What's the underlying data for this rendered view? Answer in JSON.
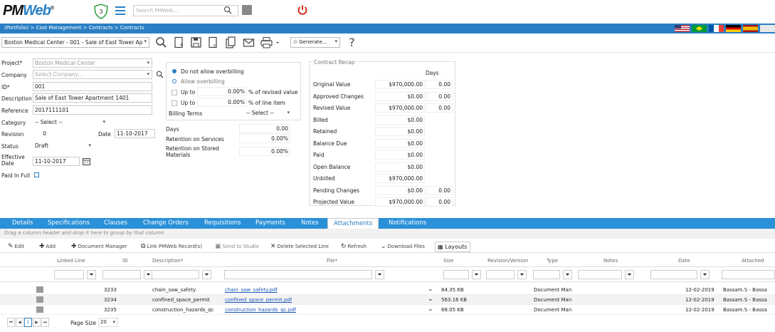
{
  "app": {
    "logo_text_a": "PM",
    "logo_text_b": "Web",
    "reg_mark": "®",
    "shield_count": "3",
    "search_placeholder": "Search PMWeb...",
    "breadcrumb": "(Portfolio) > Cost Management > Contracts > Contracts",
    "flags": [
      "us-flag",
      "br-flag",
      "fr-flag",
      "de-flag",
      "es-flag"
    ]
  },
  "toolbar": {
    "record": "Boston Medical Center - 001 - Sale of East Tower Ap",
    "generate": "Generate...",
    "help": "?"
  },
  "form": {
    "project_label": "Project*",
    "project_value": "Boston Medical Center",
    "company_label": "Company",
    "company_placeholder": "Select Company...",
    "id_label": "ID*",
    "id_value": "001",
    "description_label": "Description",
    "description_value": "Sale of East Tower Apartment 1401",
    "reference_label": "Reference",
    "reference_value": "2017111101",
    "category_label": "Category",
    "category_value": "-- Select --",
    "revision_label": "Revision",
    "revision_value": "0",
    "date_label": "Date",
    "date_value": "11-10-2017",
    "status_label": "Status",
    "status_value": "Draft",
    "effective_label_1": "Effective",
    "effective_label_2": "Date",
    "effective_value": "11-10-2017",
    "paid_label": "Paid In Full"
  },
  "billing": {
    "opt_no": "Do not allow overbilling",
    "opt_allow": "Allow overbilling",
    "upto1_label": "Up to",
    "upto1_value": "0.00%",
    "upto1_suffix": "% of revised value",
    "upto2_label": "Up to",
    "upto2_value": "0.00%",
    "upto2_suffix": "% of line item",
    "terms_label": "Billing Terms",
    "terms_value": "-- Select --",
    "days_label": "Days",
    "days_value": "0.00",
    "ret_services_label": "Retention on Services",
    "ret_services_value": "0.00%",
    "ret_stored_label_1": "Retention on Stored",
    "ret_stored_label_2": "Materials",
    "ret_stored_value": "0.00%"
  },
  "recap": {
    "title": "Contract Recap",
    "days_header": "Days",
    "rows": [
      {
        "label": "Original Value",
        "value": "$970,000.00",
        "days": "0.00"
      },
      {
        "label": "Approved Changes",
        "value": "$0.00",
        "days": "0.00"
      },
      {
        "label": "Revised Value",
        "value": "$970,000.00",
        "days": "0.00"
      },
      {
        "label": "Billed",
        "value": "$0.00",
        "days": ""
      },
      {
        "label": "Retained",
        "value": "$0.00",
        "days": ""
      },
      {
        "label": "Balance Due",
        "value": "$0.00",
        "days": ""
      },
      {
        "label": "Paid",
        "value": "$0.00",
        "days": ""
      },
      {
        "label": "Open Balance",
        "value": "$0.00",
        "days": ""
      },
      {
        "label": "Unbilled",
        "value": "$970,000.00",
        "days": ""
      },
      {
        "label": "Pending Changes",
        "value": "$0.00",
        "days": "0.00"
      },
      {
        "label": "Projected Value",
        "value": "$970,000.00",
        "days": "0.00"
      }
    ]
  },
  "tabs": [
    "Details",
    "Specifications",
    "Clauses",
    "Change Orders",
    "Requisitions",
    "Payments",
    "Notes",
    "Attachments",
    "Notifications"
  ],
  "grid": {
    "group_hint": "Drag a column header and drop it here to group by that column",
    "toolbar": {
      "edit": "Edit",
      "add": "Add",
      "doc_manager": "Document Manager",
      "link": "Link PMWeb Record(s)",
      "studio": "Send to Studio",
      "delete": "Delete Selected Line",
      "refresh": "Refresh",
      "download": "Download Files",
      "layouts": "Layouts"
    },
    "columns": [
      "Linked Line",
      "ID",
      "Description*",
      "File*",
      "Size",
      "Revision/Version",
      "Type",
      "Notes",
      "Date",
      "Attached"
    ],
    "rows": [
      {
        "id": "3233",
        "description": "chain_saw_safety",
        "file": "chain_saw_safety.pdf",
        "size": "84.35 KB",
        "type": "Document Man",
        "date": "12-02-2019",
        "attached": "Bassam.S - Bassa"
      },
      {
        "id": "3234",
        "description": "confined_space_permit",
        "file": "confined_space_permit.pdf",
        "size": "563.16 KB",
        "type": "Document Man",
        "date": "12-02-2019",
        "attached": "Bassam.S - Bassa"
      },
      {
        "id": "3235",
        "description": "construction_hazards_qc",
        "file": "construction_hazards_qc.pdf",
        "size": "68.05 KB",
        "type": "Document Man",
        "date": "12-02-2019",
        "attached": "Bassam.S - Bassa"
      }
    ],
    "pager": {
      "current": "1",
      "page_size_label": "Page Size",
      "page_size": "20"
    }
  },
  "colors": {
    "accent": "#2a7fc4",
    "tabbar": "#2a90d8",
    "power": "#d9261c"
  }
}
